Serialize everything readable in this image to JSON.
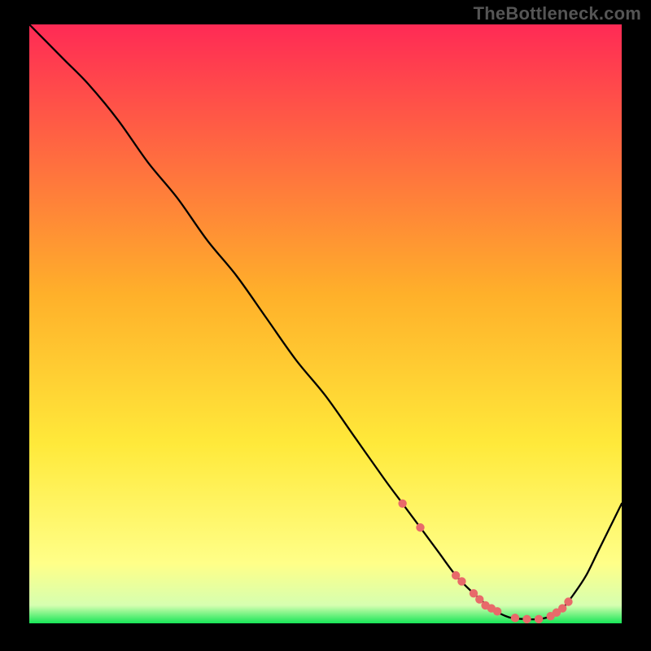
{
  "attribution": "TheBottleneck.com",
  "colors": {
    "gradient_top": "#ff2a55",
    "gradient_mid": "#ffcf2a",
    "gradient_low": "#ffff88",
    "gradient_bottom": "#17e657",
    "curve": "#000000",
    "marker": "#e86a6a",
    "frame_bg": "#000000"
  },
  "chart_data": {
    "type": "line",
    "title": "",
    "xlabel": "",
    "ylabel": "",
    "xlim": [
      0,
      100
    ],
    "ylim": [
      0,
      100
    ],
    "series": [
      {
        "name": "bottleneck-curve",
        "x": [
          0,
          3,
          6,
          10,
          15,
          20,
          25,
          30,
          35,
          40,
          45,
          50,
          55,
          60,
          63,
          66,
          69,
          72,
          75,
          78,
          81,
          84,
          86,
          88,
          90,
          92,
          94,
          96,
          98,
          100
        ],
        "y": [
          100,
          97,
          94,
          90,
          84,
          77,
          71,
          64,
          58,
          51,
          44,
          38,
          31,
          24,
          20,
          16,
          12,
          8,
          5,
          2.5,
          1.0,
          0.7,
          0.7,
          1.2,
          2.5,
          5,
          8,
          12,
          16,
          20
        ]
      }
    ],
    "markers": {
      "name": "highlighted-range",
      "x": [
        63,
        66,
        72,
        73,
        75,
        76,
        77,
        78,
        79,
        82,
        84,
        86,
        88,
        89,
        90,
        91
      ],
      "y": [
        20,
        16,
        8,
        7,
        5,
        4,
        3,
        2.5,
        2,
        0.9,
        0.7,
        0.7,
        1.2,
        1.8,
        2.5,
        3.6
      ]
    }
  }
}
